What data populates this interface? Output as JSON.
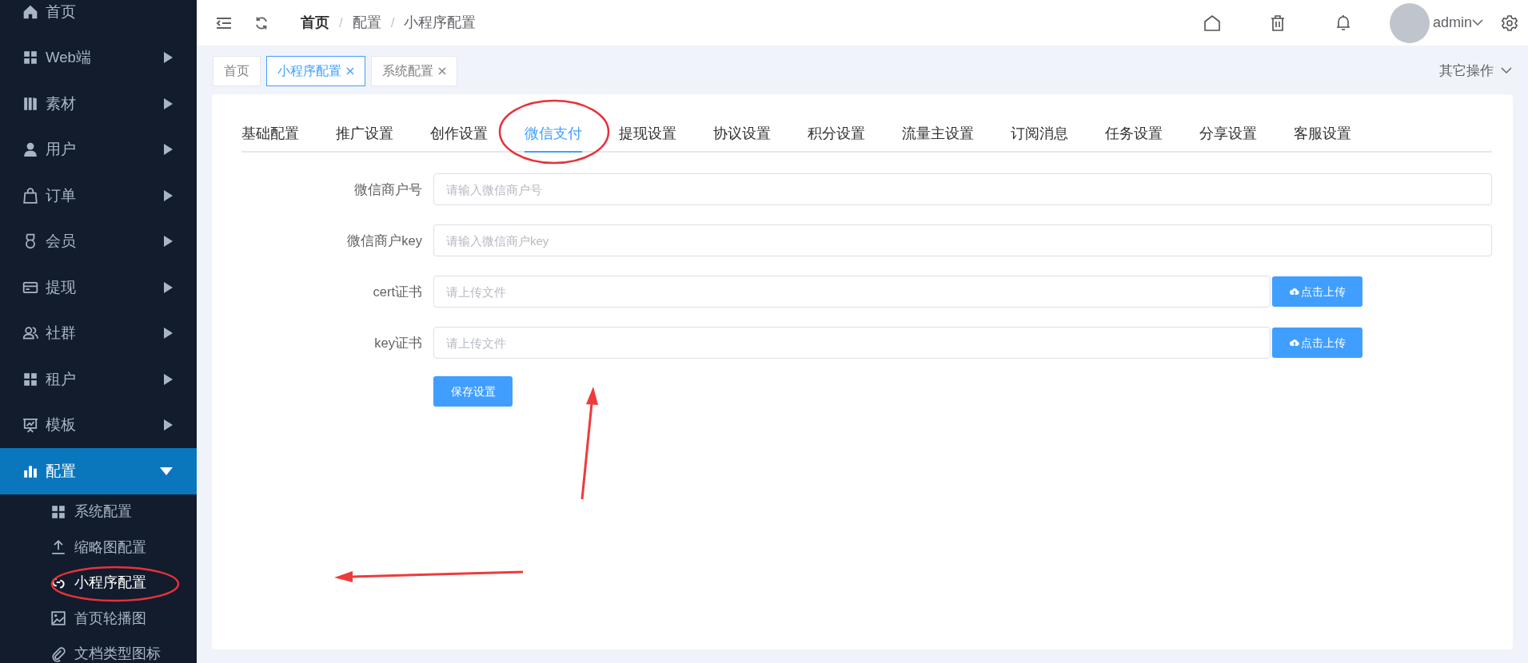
{
  "sidebar": {
    "items": [
      {
        "label": "首页",
        "expandable": false,
        "selected": false
      },
      {
        "label": "Web端",
        "expandable": true,
        "expanded": false,
        "selected": false
      },
      {
        "label": "素材",
        "expandable": true,
        "expanded": false,
        "selected": false
      },
      {
        "label": "用户",
        "expandable": true,
        "expanded": false,
        "selected": false
      },
      {
        "label": "订单",
        "expandable": true,
        "expanded": false,
        "selected": false
      },
      {
        "label": "会员",
        "expandable": true,
        "expanded": false,
        "selected": false
      },
      {
        "label": "提现",
        "expandable": true,
        "expanded": false,
        "selected": false
      },
      {
        "label": "社群",
        "expandable": true,
        "expanded": false,
        "selected": false
      },
      {
        "label": "租户",
        "expandable": true,
        "expanded": false,
        "selected": false
      },
      {
        "label": "模板",
        "expandable": true,
        "expanded": false,
        "selected": false
      },
      {
        "label": "配置",
        "expandable": true,
        "expanded": true,
        "selected": true,
        "children": [
          {
            "label": "系统配置",
            "selected": false
          },
          {
            "label": "缩略图配置",
            "selected": false
          },
          {
            "label": "小程序配置",
            "selected": true
          },
          {
            "label": "首页轮播图",
            "selected": false
          },
          {
            "label": "文档类型图标",
            "selected": false
          }
        ]
      }
    ]
  },
  "header": {
    "breadcrumb": [
      {
        "kind": "link",
        "label": "首页",
        "emphasized": true
      },
      {
        "kind": "separator",
        "label": "/"
      },
      {
        "kind": "link",
        "label": "配置",
        "emphasized": false
      },
      {
        "kind": "separator",
        "label": "/"
      },
      {
        "kind": "link",
        "label": "小程序配置",
        "emphasized": false
      }
    ],
    "user": {
      "name": "admin"
    }
  },
  "page_tabs": [
    {
      "label": "首页",
      "selected": false,
      "closable": false
    },
    {
      "label": "小程序配置",
      "selected": true,
      "closable": true
    },
    {
      "label": "系统配置",
      "selected": false,
      "closable": true
    }
  ],
  "other_actions": "其它操作",
  "settings_tabs": [
    {
      "label": "基础配置",
      "selected": false
    },
    {
      "label": "推广设置",
      "selected": false
    },
    {
      "label": "创作设置",
      "selected": false
    },
    {
      "label": "微信支付",
      "selected": true
    },
    {
      "label": "提现设置",
      "selected": false
    },
    {
      "label": "协议设置",
      "selected": false
    },
    {
      "label": "积分设置",
      "selected": false
    },
    {
      "label": "流量主设置",
      "selected": false
    },
    {
      "label": "订阅消息",
      "selected": false
    },
    {
      "label": "任务设置",
      "selected": false
    },
    {
      "label": "分享设置",
      "selected": false
    },
    {
      "label": "客服设置",
      "selected": false
    }
  ],
  "form": {
    "fields": [
      {
        "kind": "text",
        "label": "微信商户号",
        "placeholder": "请输入微信商户号"
      },
      {
        "kind": "text",
        "label": "微信商户key",
        "placeholder": "请输入微信商户key"
      },
      {
        "kind": "upload",
        "label": "cert证书",
        "placeholder": "请上传文件",
        "button": "点击上传"
      },
      {
        "kind": "upload",
        "label": "key证书",
        "placeholder": "请上传文件",
        "button": "点击上传"
      }
    ],
    "save_button": "保存设置"
  }
}
